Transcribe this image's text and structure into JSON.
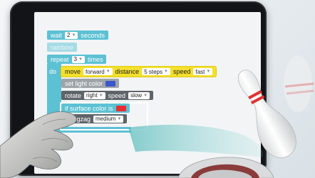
{
  "colors": {
    "teal": "#5cc1d3",
    "yellow": "#f3df2e",
    "dark_gray": "#5f6469",
    "light_gray": "#9ea4a9",
    "light_color_swatch": "#3a58c9",
    "surface_color_swatch": "#e62e2e"
  },
  "blocks": {
    "wait": {
      "label": "wait",
      "value": "2",
      "unit": "seconds"
    },
    "rainbow": {
      "label": "rainbow"
    },
    "repeat": {
      "label": "repeat",
      "value": "3",
      "unit": "times"
    },
    "do_label": "do",
    "move": {
      "label": "move",
      "direction": "forward",
      "distance_label": "distance",
      "distance_value": "5 steps",
      "speed_label": "speed",
      "speed_value": "fast"
    },
    "set_light": {
      "label": "set light color",
      "swatch_icon": "color-swatch-blue"
    },
    "rotate": {
      "label": "rotate",
      "direction": "right",
      "speed_label": "speed",
      "speed_value": "slow"
    },
    "if_surface": {
      "label": "if surface color is",
      "swatch_icon": "color-swatch-red"
    },
    "zigzag": {
      "label": "zigzag",
      "value": "medium"
    }
  },
  "icons": {
    "dropdown": "chevron-down-icon",
    "hand": "pointing-hand",
    "pin": "bowling-pin"
  }
}
